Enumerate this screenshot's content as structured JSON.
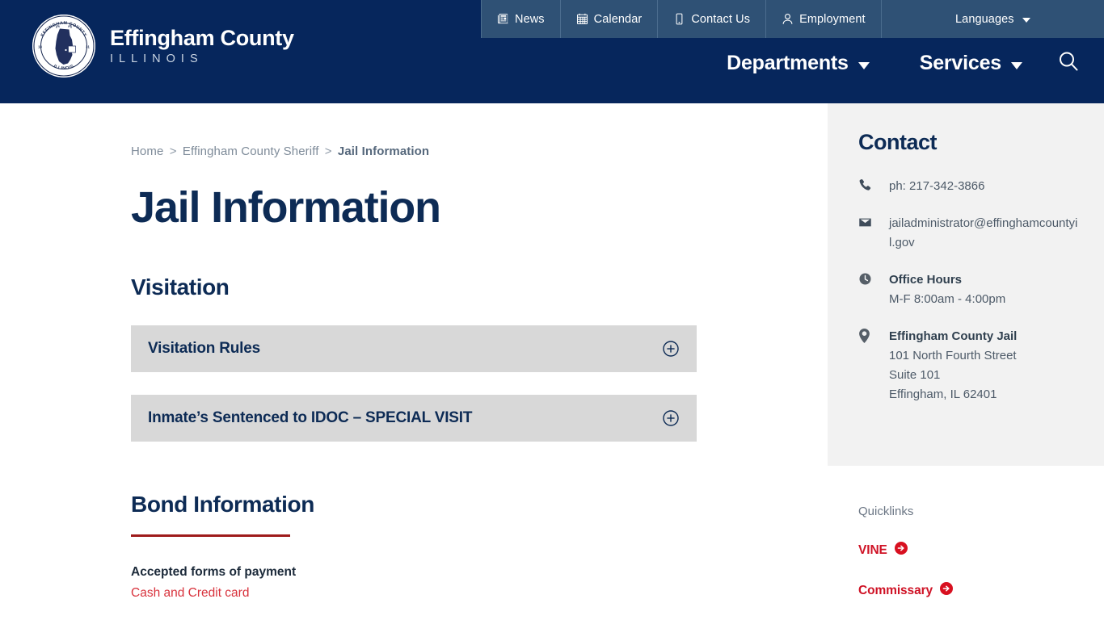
{
  "site": {
    "brand_name": "Effingham County",
    "brand_sub": "ILLINOIS",
    "seal_top_text": "EFFINGHAM COUNTY",
    "seal_bottom_text": "ILLINOIS"
  },
  "utility_nav": {
    "items": [
      {
        "label": "News",
        "icon": "newspaper-icon"
      },
      {
        "label": "Calendar",
        "icon": "calendar-icon"
      },
      {
        "label": "Contact Us",
        "icon": "mobile-phone-icon"
      },
      {
        "label": "Employment",
        "icon": "user-icon"
      },
      {
        "label": "Languages",
        "icon": "chevron-down-icon"
      }
    ]
  },
  "main_nav": {
    "items": [
      {
        "label": "Departments"
      },
      {
        "label": "Services"
      }
    ],
    "search_icon": "search-icon"
  },
  "breadcrumb": {
    "home": "Home",
    "sep": ">",
    "parent": "Effingham County Sheriff",
    "current": "Jail Information"
  },
  "main": {
    "page_title": "Jail Information",
    "visitation_heading": "Visitation",
    "accordion": [
      {
        "title": "Visitation Rules",
        "toggle_icon": "circle-plus-icon"
      },
      {
        "title": "Inmate’s Sentenced to IDOC – SPECIAL VISIT",
        "toggle_icon": "circle-plus-icon"
      }
    ],
    "bond_heading": "Bond Information",
    "bond_payment_label": "Accepted forms of payment",
    "bond_payment_value": "Cash and Credit card"
  },
  "sidebar": {
    "contact_title": "Contact",
    "phone": {
      "icon": "phone-icon",
      "text": "ph: 217-342-3866"
    },
    "email": {
      "icon": "envelope-icon",
      "text": "jailadministrator@effinghamcountyil.gov"
    },
    "hours": {
      "icon": "clock-icon",
      "label": "Office Hours",
      "value": "M-F 8:00am - 4:00pm"
    },
    "address": {
      "icon": "map-pin-icon",
      "name": "Effingham County Jail",
      "line1": "101 North Fourth Street",
      "line2": "Suite 101",
      "line3": "Effingham, IL 62401"
    },
    "quicklinks_title": "Quicklinks",
    "quicklinks": [
      {
        "label": "VINE",
        "icon": "arrow-circle-right-icon"
      },
      {
        "label": "Commissary",
        "icon": "arrow-circle-right-icon"
      }
    ]
  },
  "colors": {
    "header_navy": "#06265c",
    "utility_blue": "#2f5175",
    "heading_navy": "#0d2b55",
    "accent_red": "#cf1225",
    "rule_red": "#9e1b1b",
    "accordion_gray": "#d8d8d8",
    "panel_gray": "#f2f2f2"
  }
}
